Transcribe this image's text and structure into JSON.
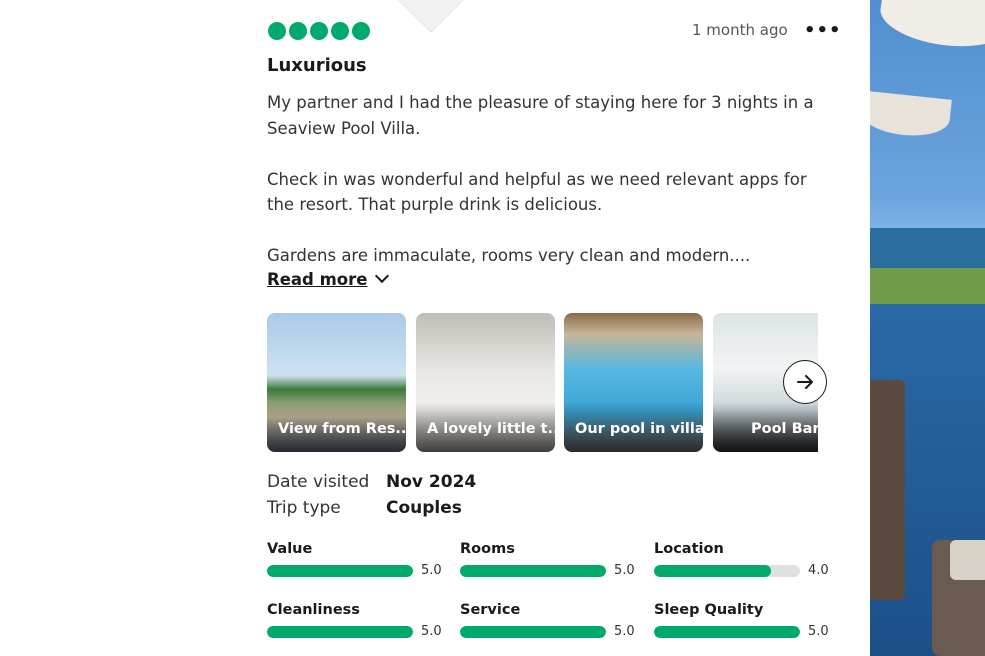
{
  "review": {
    "time": "1 month ago",
    "title": "Luxurious",
    "paragraphs": [
      "My partner and I had the pleasure of staying here for 3 nights in a Seaview Pool Villa.",
      "Check in was wonderful and helpful as we need relevant apps for the resort. That purple drink is delicious.",
      "Gardens are immaculate, rooms very clean and modern...."
    ],
    "read_more": "Read more",
    "bubble_rating": 5
  },
  "photos": [
    {
      "caption": "View from Res..."
    },
    {
      "caption": "A lovely little t..."
    },
    {
      "caption": "Our pool in villa"
    },
    {
      "caption": "Pool Bar"
    }
  ],
  "meta": {
    "date_label": "Date visited",
    "date_value": "Nov 2024",
    "trip_label": "Trip type",
    "trip_value": "Couples"
  },
  "ratings": [
    {
      "label": "Value",
      "score": "5.0",
      "fraction": 1.0
    },
    {
      "label": "Rooms",
      "score": "5.0",
      "fraction": 1.0
    },
    {
      "label": "Location",
      "score": "4.0",
      "fraction": 0.8
    },
    {
      "label": "Cleanliness",
      "score": "5.0",
      "fraction": 1.0
    },
    {
      "label": "Service",
      "score": "5.0",
      "fraction": 1.0
    },
    {
      "label": "Sleep Quality",
      "score": "5.0",
      "fraction": 1.0
    }
  ],
  "colors": {
    "accent": "#00aa6c"
  },
  "icons": {
    "more": "more-horizontal-icon",
    "chevron": "chevron-down-icon",
    "next": "arrow-right-icon"
  }
}
